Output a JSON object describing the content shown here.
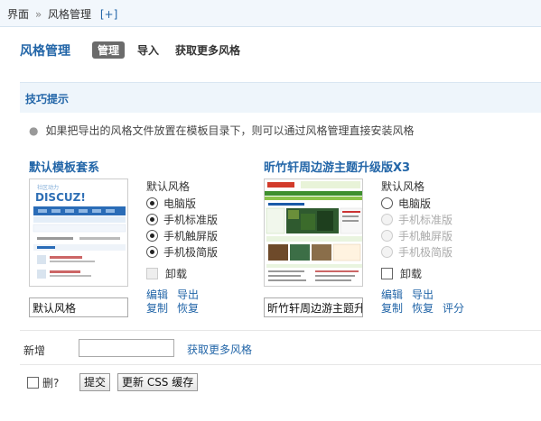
{
  "breadcrumb": {
    "root": "界面",
    "separator": "»",
    "current": "风格管理",
    "add": "[+]"
  },
  "header": {
    "title": "风格管理",
    "tabs": [
      {
        "label": "管理",
        "active": true
      },
      {
        "label": "导入",
        "active": false
      },
      {
        "label": "获取更多风格",
        "active": false
      }
    ]
  },
  "tips": {
    "title": "技巧提示",
    "line": "如果把导出的风格文件放置在模板目录下，则可以通过风格管理直接安装风格"
  },
  "styles": [
    {
      "title": "默认模板套系",
      "options_heading": "默认风格",
      "options": [
        {
          "label": "电脑版",
          "checked": true,
          "disabled": false
        },
        {
          "label": "手机标准版",
          "checked": true,
          "disabled": false
        },
        {
          "label": "手机触屏版",
          "checked": true,
          "disabled": false
        },
        {
          "label": "手机极简版",
          "checked": true,
          "disabled": false
        }
      ],
      "uninstall": {
        "label": "卸载",
        "disabled": true
      },
      "actions": [
        "编辑",
        "导出",
        "复制",
        "恢复"
      ],
      "name_value": "默认风格",
      "thumb_brand": "DISCUZ!"
    },
    {
      "title": "昕竹轩周边游主题升级版X3",
      "options_heading": "默认风格",
      "options": [
        {
          "label": "电脑版",
          "checked": false,
          "disabled": false
        },
        {
          "label": "手机标准版",
          "checked": false,
          "disabled": true
        },
        {
          "label": "手机触屏版",
          "checked": false,
          "disabled": true
        },
        {
          "label": "手机极简版",
          "checked": false,
          "disabled": true
        }
      ],
      "uninstall": {
        "label": "卸载",
        "disabled": false
      },
      "actions": [
        "编辑",
        "导出",
        "复制",
        "恢复",
        "评分"
      ],
      "name_value": "昕竹轩周边游主题升"
    }
  ],
  "new_row": {
    "label": "新增",
    "input_value": "",
    "more_link": "获取更多风格"
  },
  "footer": {
    "delete_label": "删?",
    "submit_label": "提交",
    "update_css_label": "更新 CSS 缓存"
  },
  "colors": {
    "accent": "#2366a8",
    "tip_bg": "#eef5fb",
    "active_tab_bg": "#6b6b6b"
  }
}
